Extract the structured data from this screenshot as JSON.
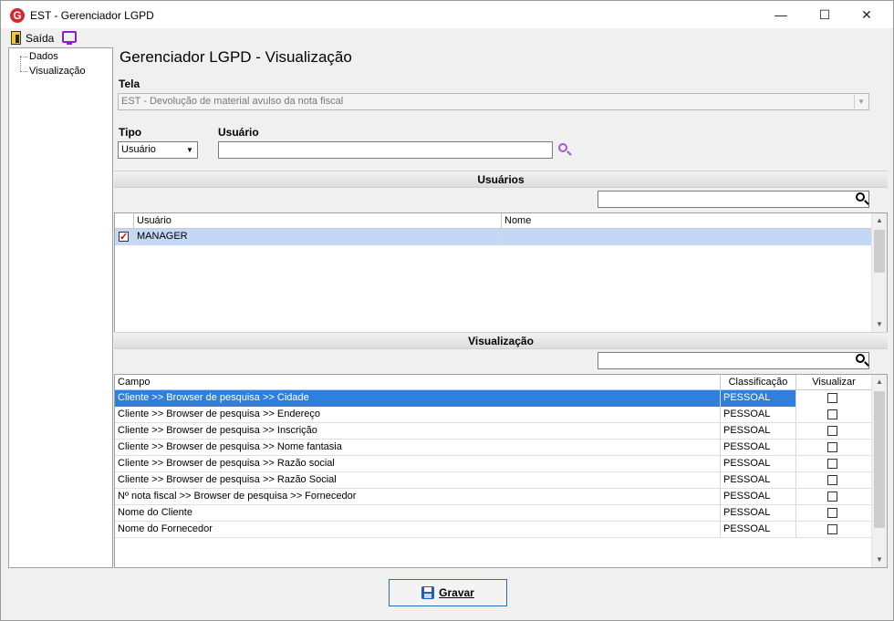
{
  "window": {
    "title": "EST - Gerenciador LGPD",
    "minimize": "—",
    "maximize": "☐",
    "close": "✕"
  },
  "menu": {
    "exit_label": "Saída"
  },
  "sidebar": {
    "items": [
      {
        "label": "Dados"
      },
      {
        "label": "Visualização"
      }
    ]
  },
  "header": {
    "title": "Gerenciador LGPD - Visualização"
  },
  "form": {
    "tela_label": "Tela",
    "tela_value": "EST - Devolução de material avulso da nota fiscal",
    "tipo_label": "Tipo",
    "tipo_value": "Usuário",
    "usuario_label": "Usuário",
    "usuario_value": ""
  },
  "users_section": {
    "title": "Usuários",
    "search_value": "",
    "columns": [
      "Usuário",
      "Nome"
    ],
    "rows": [
      {
        "checked": true,
        "usuario": "MANAGER",
        "nome": ""
      }
    ]
  },
  "view_section": {
    "title": "Visualização",
    "search_value": "",
    "columns": [
      "Campo",
      "Classificação",
      "Visualizar"
    ],
    "rows": [
      {
        "campo": "Cliente >> Browser de pesquisa >> Cidade",
        "classificacao": "PESSOAL",
        "visualizar": false
      },
      {
        "campo": "Cliente >> Browser de pesquisa >> Endereço",
        "classificacao": "PESSOAL",
        "visualizar": false
      },
      {
        "campo": "Cliente >> Browser de pesquisa >> Inscrição",
        "classificacao": "PESSOAL",
        "visualizar": false
      },
      {
        "campo": "Cliente >> Browser de pesquisa >> Nome fantasia",
        "classificacao": "PESSOAL",
        "visualizar": false
      },
      {
        "campo": "Cliente >> Browser de pesquisa >> Razão social",
        "classificacao": "PESSOAL",
        "visualizar": false
      },
      {
        "campo": "Cliente >> Browser de pesquisa >> Razão Social",
        "classificacao": "PESSOAL",
        "visualizar": false
      },
      {
        "campo": "Nº nota fiscal >> Browser de pesquisa >> Fornecedor",
        "classificacao": "PESSOAL",
        "visualizar": false
      },
      {
        "campo": "Nome do Cliente",
        "classificacao": "PESSOAL",
        "visualizar": false
      },
      {
        "campo": "Nome do Fornecedor",
        "classificacao": "PESSOAL",
        "visualizar": false
      }
    ]
  },
  "footer": {
    "save_label": "Gravar"
  },
  "colors": {
    "selection": "#2f7fdc",
    "selection_light": "#c4d8f5",
    "brand": "#d9262b",
    "accent": "#8b1fc8"
  },
  "icons": {
    "logo": "app-logo-icon",
    "exit": "exit-door-icon",
    "monitor": "monitor-icon",
    "search": "search-icon",
    "save": "save-disk-icon"
  }
}
